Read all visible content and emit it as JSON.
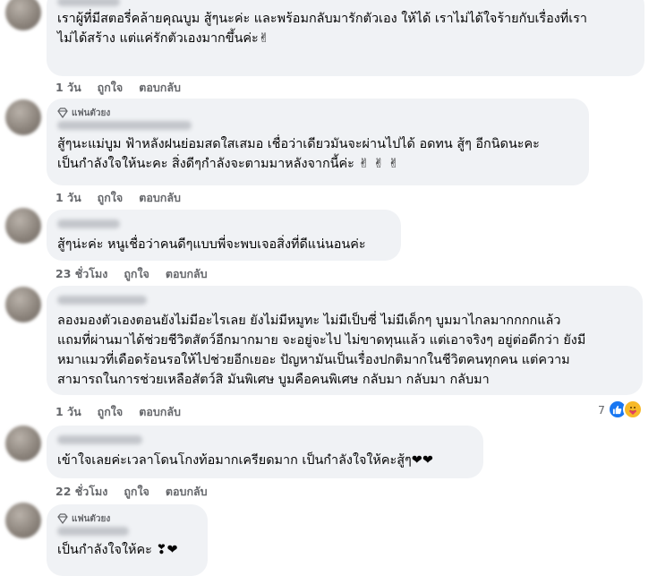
{
  "comments": [
    {
      "badge": "",
      "lines": [
        "เราผู้ที่มีสตอรี่คล้ายคุณบูม สู้ๆนะค่ะ และพร้อมกลับมารักตัวเอง ให้ได้ เราไม่ได้ใจร้ายกับเรื่องที่เรา",
        "ไม่ได้สร้าง แต่แค่รักตัวเองมากขึ้นค่ะ✌"
      ],
      "time": "1 วัน",
      "like": "ถูกใจ",
      "reply": "ตอบกลับ"
    },
    {
      "badge": "แฟนตัวยง",
      "lines": [
        "สู้ๆนะแม่บูม ฟ้าหลังฝนย่อมสดใสเสมอ เชื่อว่าเดียวมันจะผ่านไปได้ อดทน สู้ๆ อีกนิดนะคะ",
        "เป็นกำลังใจให้นะคะ สิ่งดีๆกำลังจะตามมาหลังจากนี้ค่ะ ✌ ✌ ✌"
      ],
      "time": "1 วัน",
      "like": "ถูกใจ",
      "reply": "ตอบกลับ"
    },
    {
      "badge": "",
      "lines": [
        "สู้ๆน่ะค่ะ หนูเชื่อว่าคนดีๆแบบพี่จะพบเจอสิ่งที่ดีแน่นอนค่ะ"
      ],
      "time": "23 ชั่วโมง",
      "like": "ถูกใจ",
      "reply": "ตอบกลับ"
    },
    {
      "badge": "",
      "lines": [
        "ลองมองตัวเองตอนยังไม่มีอะไรเลย ยังไม่มีหมูทะ ไม่มีเป็บซี่ ไม่มีเด็กๆ บูมมาไกลมากกกกแล้ว",
        "แถมที่ผ่านมาได้ช่วยชีวิตสัตว์อีกมากมาย จะอยู่จะไป ไม่ขาดทุนแล้ว แต่เอาจริงๆ อยู่ต่อดีกว่า ยังมี",
        "หมาแมวที่เดือดร้อนรอให้ไปช่วยอีกเยอะ ปัญหามันเป็นเรื่องปกติมากในชีวิตคนทุกคน แต่ความ",
        "สามารถในการช่วยเหลือสัตว์สิ มันพิเศษ บูมคือคนพิเศษ กลับมา กลับมา กลับมา"
      ],
      "time": "1 วัน",
      "like": "ถูกใจ",
      "reply": "ตอบกลับ",
      "reaction_count": "7"
    },
    {
      "badge": "",
      "lines": [
        "เข้าใจเลยค่ะเวลาโดนโกงท้อมากเครียดมาก เป็นกำลังใจให้คะสู้ๆ❤❤"
      ],
      "time": "22 ชั่วโมง",
      "like": "ถูกใจ",
      "reply": "ตอบกลับ"
    },
    {
      "badge": "แฟนตัวยง",
      "lines": [
        "เป็นกำลังใจให้คะ ❣❤"
      ],
      "time": "",
      "like": "",
      "reply": ""
    }
  ],
  "colors": {
    "bubble": "#f0f2f5",
    "meta": "#65676b",
    "like": "#1877f2",
    "care": "#f7b928"
  },
  "icons": {
    "badge": "diamond-icon",
    "reaction_like": "thumbs-up-icon",
    "reaction_care": "care-icon"
  }
}
